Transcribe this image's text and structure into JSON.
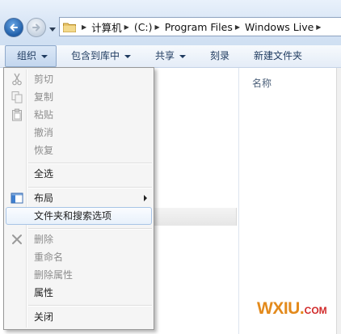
{
  "address_bar": {
    "crumbs": [
      "计算机",
      "(C:)",
      "Program Files",
      "Windows Live"
    ]
  },
  "toolbar": {
    "organize": "组织",
    "include_in_library": "包含到库中",
    "share": "共享",
    "burn": "刻录",
    "new_folder": "新建文件夹"
  },
  "columns": {
    "name": "名称"
  },
  "menu": {
    "items": [
      {
        "label": "剪切",
        "icon": "scissors-icon",
        "enabled": false
      },
      {
        "label": "复制",
        "icon": "copy-icon",
        "enabled": false
      },
      {
        "label": "粘贴",
        "icon": "paste-icon",
        "enabled": false
      },
      {
        "label": "撤消",
        "enabled": false
      },
      {
        "label": "恢复",
        "enabled": false
      },
      {
        "label": "全选",
        "enabled": true
      },
      {
        "label": "布局",
        "icon": "layout-icon",
        "enabled": true,
        "submenu": true
      },
      {
        "label": "文件夹和搜索选项",
        "enabled": true,
        "highlighted": true
      },
      {
        "label": "删除",
        "icon": "delete-x-icon",
        "enabled": false
      },
      {
        "label": "重命名",
        "enabled": false
      },
      {
        "label": "删除属性",
        "enabled": false
      },
      {
        "label": "属性",
        "enabled": true
      },
      {
        "label": "关闭",
        "enabled": true
      }
    ]
  },
  "watermark": {
    "main": "WXIU",
    "dot": ".",
    "suffix": "COM"
  },
  "colors": {
    "highlight_border": "#a8c4e6",
    "watermark_orange": "#e38a1c",
    "watermark_red": "#d12a2a"
  }
}
